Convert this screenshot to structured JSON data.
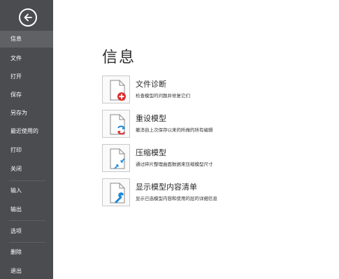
{
  "sidebar": {
    "back_icon": "back-arrow-circle-icon",
    "items": [
      {
        "label": "信息",
        "active": true
      },
      {
        "label": "文件"
      },
      {
        "label": "打开"
      },
      {
        "label": "保存"
      },
      {
        "label": "另存为"
      },
      {
        "label": "最近使用的"
      },
      {
        "label": "打印"
      },
      {
        "label": "关闭"
      },
      {
        "label": "输入"
      },
      {
        "label": "输出"
      },
      {
        "label": "选项"
      },
      {
        "label": "删除"
      },
      {
        "label": "退出"
      }
    ]
  },
  "main": {
    "title": "信息",
    "actions": [
      {
        "title": "文件诊断",
        "desc": "检查模型的问题并修复它们",
        "icon": "document-diagnose-icon",
        "badge_color": "#e02a2a"
      },
      {
        "title": "重设模型",
        "desc": "撤消自上次保存以来的所做的所有编辑",
        "icon": "document-reset-icon",
        "badge_color": "#1e88d8"
      },
      {
        "title": "压缩模型",
        "desc": "通过碎片整理曲面数据来压缩模型尺寸",
        "icon": "document-compress-icon",
        "badge_color": "#1e88d8"
      },
      {
        "title": "显示模型内容清单",
        "desc": "显示已选模型内容和使用的层的详细信息",
        "icon": "document-content-list-icon",
        "badge_color": "#1e88d8"
      }
    ]
  }
}
